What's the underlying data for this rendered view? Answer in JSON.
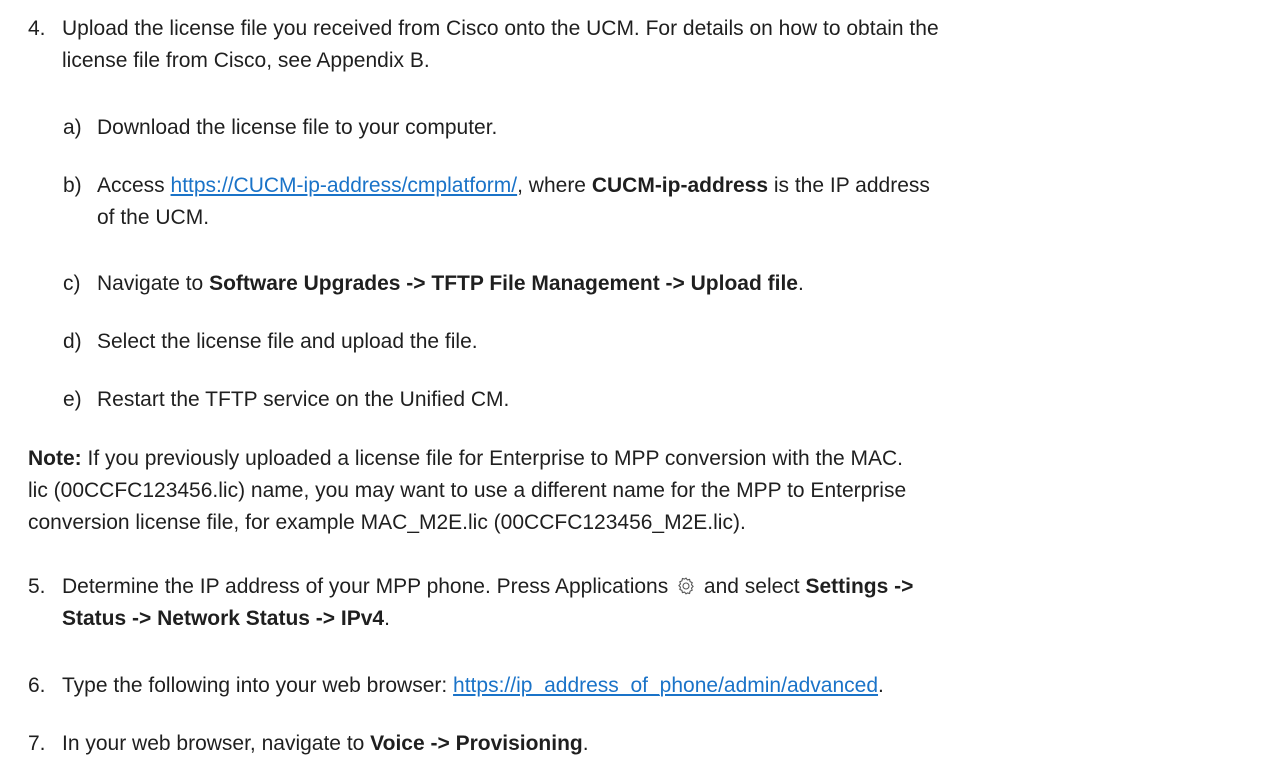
{
  "step4": {
    "num": "4.",
    "line1": "Upload the license file you received from Cisco onto the UCM. For details on how to obtain the",
    "line2": "license file from Cisco, see Appendix B."
  },
  "step4a": {
    "num": "a)",
    "text": "Download the license file to your computer."
  },
  "step4b": {
    "num": "b)",
    "pre": "Access ",
    "link": "https://CUCM-ip-address/cmplatform/",
    "mid": ", where ",
    "bold": "CUCM-ip-address",
    "post": " is the IP address",
    "line2": "of the UCM."
  },
  "step4c": {
    "num": "c)",
    "pre": "Navigate to ",
    "bold": "Software Upgrades -> TFTP File Management -> Upload file",
    "post": "."
  },
  "step4d": {
    "num": "d)",
    "text": "Select the license file and upload the file."
  },
  "step4e": {
    "num": "e)",
    "text": "Restart the TFTP service on the Unified CM."
  },
  "note": {
    "label": "Note:",
    "line1": " If you previously uploaded a license file for Enterprise to MPP conversion with the MAC.",
    "line2": "lic (00CCFC123456.lic) name, you may want to use a different name for the MPP to Enterprise",
    "line3": "conversion license file, for example MAC_M2E.lic (00CCFC123456_M2E.lic)."
  },
  "step5": {
    "num": "5.",
    "pre": "Determine the IP address of your MPP phone. Press Applications ",
    "icon": "gear-icon",
    "mid": " and select ",
    "bold1": "Settings ->",
    "bold2": "Status -> Network Status -> IPv4",
    "post": "."
  },
  "step6": {
    "num": "6.",
    "pre": "Type the following into your web browser: ",
    "link": "https://ip_address_of_phone/admin/advanced",
    "post": "."
  },
  "step7": {
    "num": "7.",
    "pre": "In your web browser, navigate to ",
    "bold": "Voice -> Provisioning",
    "post": "."
  },
  "colors": {
    "link": "#1a73c8",
    "text": "#1f1f1f"
  }
}
